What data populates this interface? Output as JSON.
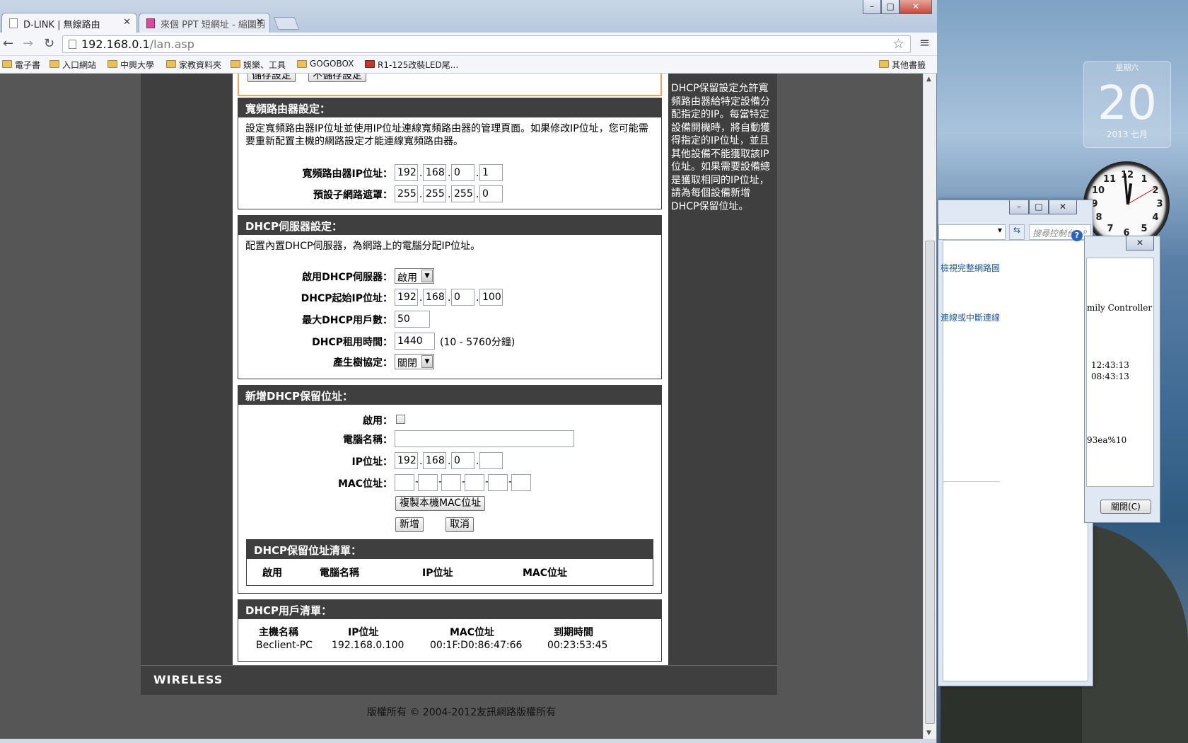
{
  "browser": {
    "tabs": [
      {
        "title": "D-LINK | 無線路由"
      },
      {
        "title": "來個 PPT 短網址 - 縮圖剪"
      }
    ],
    "url_host": "192.168.0.1",
    "url_path": "/lan.asp",
    "bookmarks": [
      "電子書",
      "入口網站",
      "中興大學",
      "家教資料夾",
      "娛樂、工具",
      "GOGOBOX",
      "R1-125改裝LED尾..."
    ],
    "other_bookmarks": "其他書籤",
    "window_buttons": {
      "minimize": "–",
      "maximize": "□",
      "close": "✕"
    }
  },
  "router": {
    "save_buttons": {
      "save": "儲存設定",
      "dont_save": "不儲存設定"
    },
    "router_settings": {
      "title": "寬頻路由器設定：",
      "description": "設定寬頻路由器IP位址並使用IP位址連線寬頻路由器的管理頁面。如果修改IP位址，您可能需要重新配置主機的網路設定才能連線寬頻路由器。",
      "ip_label": "寬頻路由器IP位址：",
      "ip": [
        "192",
        "168",
        "0",
        "1"
      ],
      "mask_label": "預設子網路遮罩：",
      "mask": [
        "255",
        "255",
        "255",
        "0"
      ]
    },
    "dhcp_server": {
      "title": "DHCP伺服器設定：",
      "description": "配置內置DHCP伺服器，為網路上的電腦分配IP位址。",
      "enable_label": "啟用DHCP伺服器：",
      "enable_value": "啟用",
      "start_ip_label": "DHCP起始IP位址：",
      "start_ip": [
        "192",
        "168",
        "0",
        "100"
      ],
      "max_users_label": "最大DHCP用戶數：",
      "max_users": "50",
      "lease_label": "DHCP租用時間：",
      "lease": "1440",
      "lease_hint": "(10 - 5760分鐘)",
      "stp_label": "產生樹協定：",
      "stp_value": "關閉"
    },
    "add_reservation": {
      "title": "新增DHCP保留位址：",
      "enable_label": "啟用：",
      "computer_name_label": "電腦名稱：",
      "computer_name": "",
      "ip_label": "IP位址：",
      "ip": [
        "192",
        "168",
        "0",
        ""
      ],
      "mac_label": "MAC位址：",
      "copy_mac_button": "複製本機MAC位址",
      "add_button": "新增",
      "cancel_button": "取消"
    },
    "reservation_list": {
      "title": "DHCP保留位址清單：",
      "columns": [
        "啟用",
        "電腦名稱",
        "IP位址",
        "MAC位址"
      ]
    },
    "client_list": {
      "title": "DHCP用戶清單：",
      "columns": [
        "主機名稱",
        "IP位址",
        "MAC位址",
        "到期時間"
      ],
      "rows": [
        [
          "Beclient-PC",
          "192.168.0.100",
          "00:1F:D0:86:47:66",
          "00:23:53:45"
        ]
      ]
    },
    "help_text": "DHCP保留設定允許寬頻路由器給特定設備分配指定的IP。每當特定設備開機時，將自動獲得指定的IP位址，並且其他設備不能獲取該IP位址。如果需要設備總是獲取相同的IP位址，請為每個設備新增DHCP保留位址。",
    "brand": "WIRELESS",
    "copyright": "版權所有 © 2004-2012友訊網路版權所有"
  },
  "desktop": {
    "calendar": {
      "weekday": "星期六",
      "day": "20",
      "month": "2013 七月"
    },
    "control_panel": {
      "search_placeholder": "搜尋控制台",
      "link1": "檢視完整網路圖",
      "link2": "連線或中斷連線",
      "close_button": "關閉(C)",
      "controller": "mily Controller",
      "time1": "12:43:13",
      "time2": "08:43:13",
      "addr": "93ea%10"
    }
  },
  "colors": {
    "header_bg": "#3f3f3f",
    "accent_border": "#f0a060"
  }
}
